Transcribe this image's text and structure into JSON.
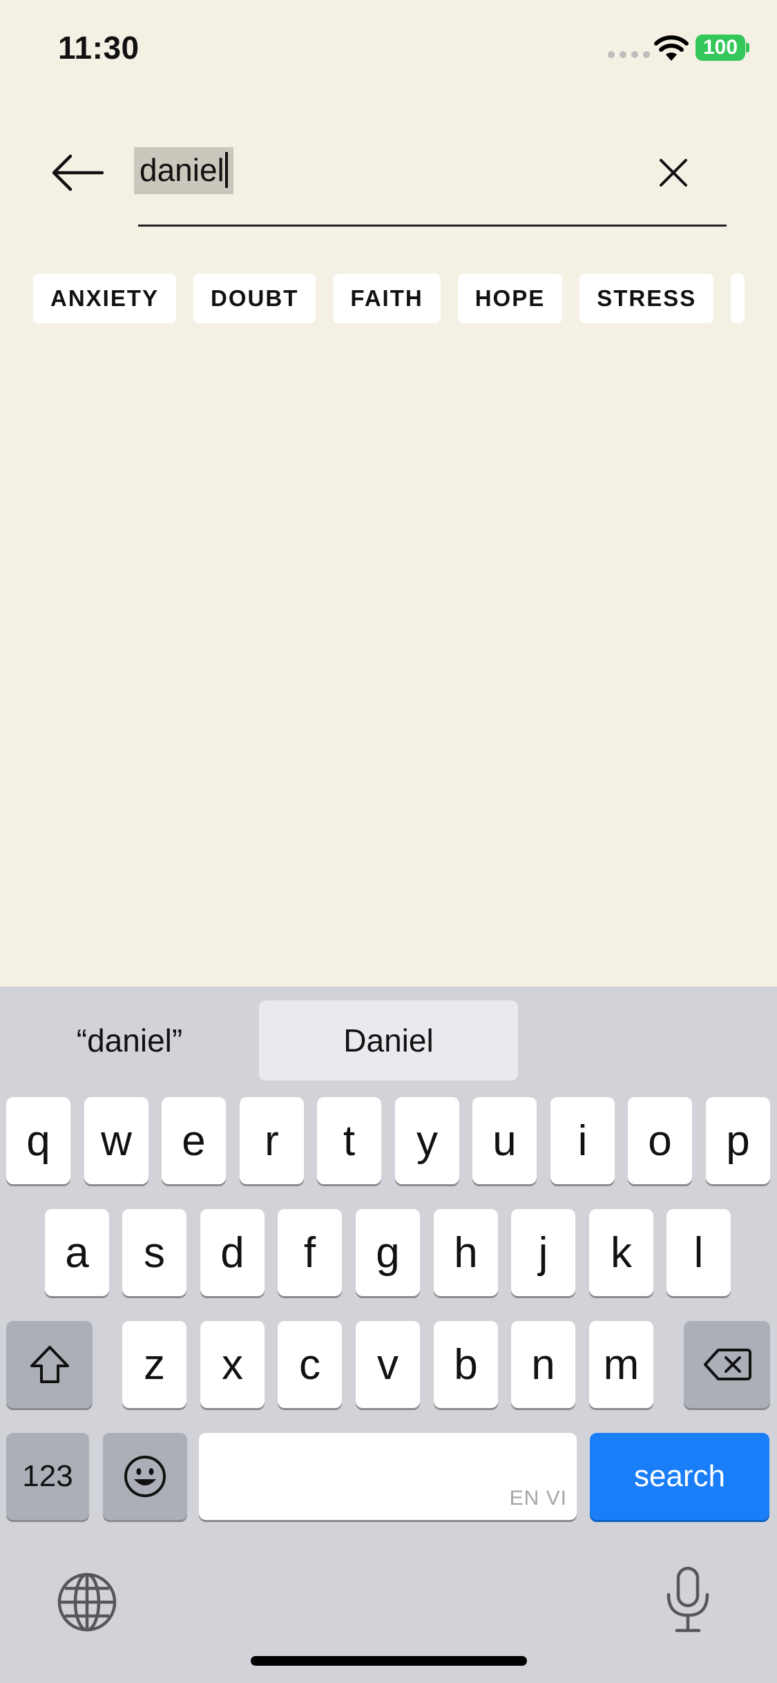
{
  "status_bar": {
    "time": "11:30",
    "battery": "100"
  },
  "search": {
    "value": "daniel"
  },
  "chips": [
    "ANXIETY",
    "DOUBT",
    "FAITH",
    "HOPE",
    "STRESS"
  ],
  "keyboard": {
    "suggestions": [
      "“daniel”",
      "Daniel",
      ""
    ],
    "row1": [
      "q",
      "w",
      "e",
      "r",
      "t",
      "y",
      "u",
      "i",
      "o",
      "p"
    ],
    "row2": [
      "a",
      "s",
      "d",
      "f",
      "g",
      "h",
      "j",
      "k",
      "l"
    ],
    "row3": [
      "z",
      "x",
      "c",
      "v",
      "b",
      "n",
      "m"
    ],
    "numbers_label": "123",
    "space_lang": "EN VI",
    "search_label": "search"
  },
  "colors": {
    "background": "#f4f0e4",
    "keyboard_bg": "#d1d3d9",
    "search_key": "#1a7ef8",
    "battery": "#34c759"
  }
}
